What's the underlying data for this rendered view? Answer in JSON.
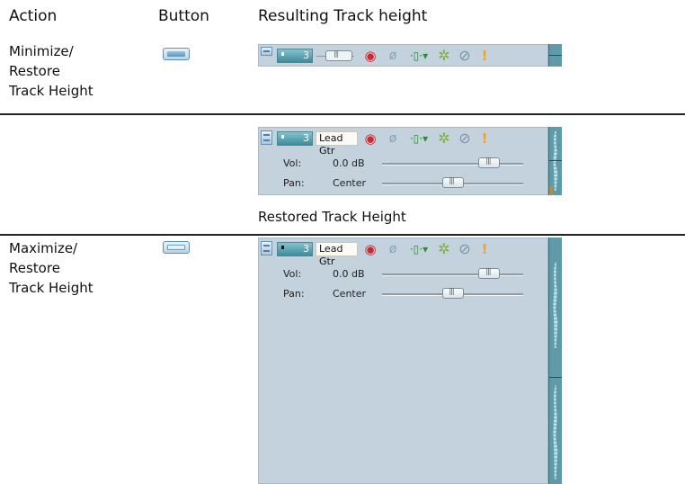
{
  "headers": {
    "action": "Action",
    "button": "Button",
    "result": "Resulting Track height"
  },
  "rows": [
    {
      "action_lines": [
        "Minimize/",
        "Restore",
        "Track Height"
      ],
      "button_icon": "minimize-track-height-icon"
    },
    {
      "caption": "Restored Track Height"
    },
    {
      "action_lines": [
        "Maximize/",
        "Restore",
        "Track Height"
      ],
      "button_icon": "maximize-track-height-icon"
    }
  ],
  "track": {
    "number": "3",
    "name": "Lead Gtr",
    "vol_label": "Vol:",
    "vol_value": "0.0 dB",
    "pan_label": "Pan:",
    "pan_value": "Center",
    "vol_level": 0.76,
    "pan_level": 0.5
  },
  "icons": {
    "record": "record-arm-icon",
    "phase": "invert-phase-icon",
    "fx": "track-fx-icon",
    "automation": "automation-settings-icon",
    "mute": "mute-icon",
    "solo": "solo-icon"
  }
}
